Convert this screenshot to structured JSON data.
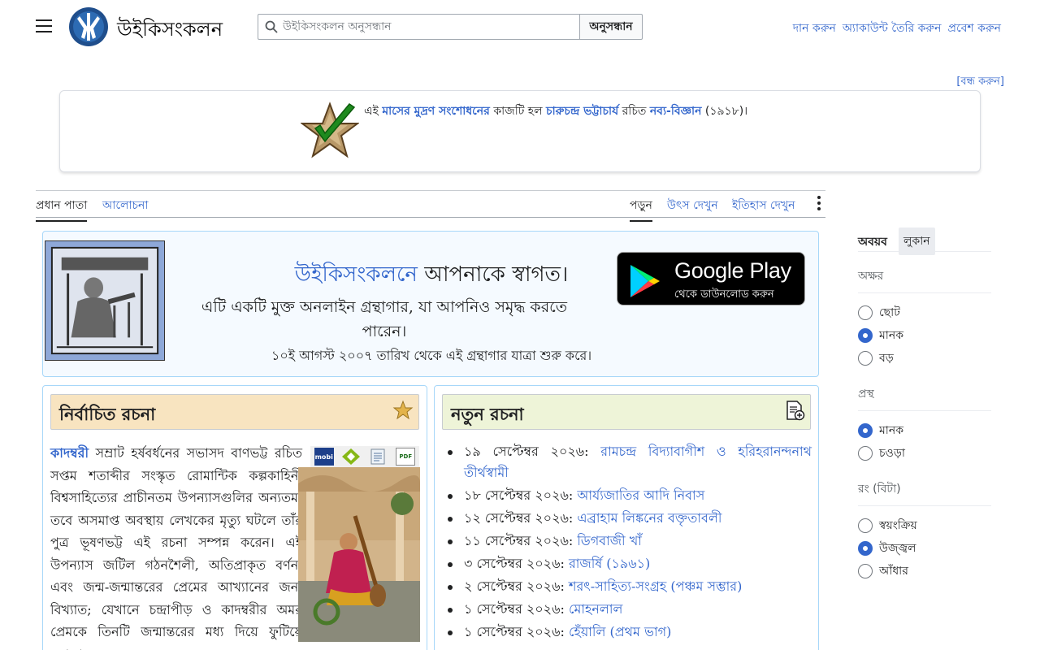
{
  "header": {
    "site_name": "উইকিসংকলন",
    "search_placeholder": "উইকিসংকলন অনুসন্ধান",
    "search_button": "অনুসন্ধান",
    "user_links": [
      "দান করুন",
      "অ্যাকাউন্ট তৈরি করুন",
      "প্রবেশ করুন"
    ]
  },
  "notice": {
    "close_label": "[বন্ধ করুন]",
    "text_prefix": "এই",
    "link1": "মাসের মুদ্রণ সংশোধনের",
    "text_mid1": " কাজটি হল ",
    "link2": "চারুচন্দ্র ভট্টাচার্য",
    "text_mid2": " রচিত ",
    "link3": "নব্য-বিজ্ঞান",
    "text_suffix": " (১৯১৮)।"
  },
  "tabs": {
    "left": [
      "প্রধান পাতা",
      "আলোচনা"
    ],
    "right": [
      "পড়ুন",
      "উৎস দেখুন",
      "ইতিহাস দেখুন"
    ]
  },
  "welcome": {
    "title_link": "উইকিসংকলনে",
    "title_rest": " আপনাকে স্বাগত।",
    "subtitle": "এটি একটি মুক্ত অনলাইন গ্রন্থাগার, যা আপনিও সমৃদ্ধ করতে পারেন।",
    "since": "১০ই আগস্ট ২০০৭ তারিখ থেকে এই গ্রন্থাগার যাত্রা শুরু করে।",
    "gplay_title": "Google Play",
    "gplay_sub": "থেকে ডাউনলোড করুন"
  },
  "featured": {
    "title": "নির্বাচিত রচনা",
    "lead_link": "কাদম্বরী",
    "body": " সম্রাট হর্ষবর্ধনের সভাসদ বাণভট্ট রচিত সপ্তম শতাব্দীর সংস্কৃত রোমান্টিক কল্পকাহিনী বিশ্বসাহিত্যের প্রাচীনতম উপন্যাসগুলির অন্যতম, তবে অসমাপ্ত অবস্থায় লেখকের মৃত্যু ঘটলে তাঁর পুত্র ভূষণভট্ট এই রচনা সম্পন্ন করেন। এই উপন্যাস জটিল গঠনশৈলী, অতিপ্রাকৃত বর্ণনা এবং জন্ম-জন্মান্তরের প্রেমের আখ্যানের জন্য বিখ্যাত; যেখানে চন্দ্রাপীড় ও কাদম্বরীর অমর প্রেমকে তিনটি জন্মান্তরের মধ্য দিয়ে ফুটিয়ে তোলা",
    "format_labels": [
      "mobi",
      "PDF"
    ]
  },
  "new_works": {
    "title": "নতুন রচনা",
    "items": [
      {
        "date": "১৯ সেপ্টেম্বর ২০২৬:",
        "title": "রামচন্দ্র বিদ্যাবাগীশ ও হরিহরানন্দনাথ তীর্থস্বামী"
      },
      {
        "date": "১৮ সেপ্টেম্বর ২০২৬:",
        "title": "আর্য্যজাতির আদি নিবাস"
      },
      {
        "date": "১২ সেপ্টেম্বর ২০২৬:",
        "title": "এব্রাহাম লিঙ্কনের বক্তৃতাবলী"
      },
      {
        "date": "১১ সেপ্টেম্বর ২০২৬:",
        "title": "ডিগবাজী খাঁ"
      },
      {
        "date": "৩ সেপ্টেম্বর ২০২৬:",
        "title": "রাজর্ষি (১৯৬১)"
      },
      {
        "date": "২ সেপ্টেম্বর ২০২৬:",
        "title": "শরৎ-সাহিত্য-সংগ্রহ (পঞ্চম সম্ভার)"
      },
      {
        "date": "১ সেপ্টেম্বর ২০২৬:",
        "title": "মোহনলাল"
      },
      {
        "date": "১ সেপ্টেম্বর ২০২৬:",
        "title": "হেঁয়ালি (প্রথম ভাগ)"
      }
    ]
  },
  "appearance": {
    "title": "অবয়ব",
    "hide": "লুকান",
    "text_label": "অক্ষর",
    "text_options": [
      "ছোট",
      "মানক",
      "বড়"
    ],
    "width_label": "প্রস্থ",
    "width_options": [
      "মানক",
      "চওড়া"
    ],
    "color_label": "রং (বিটা)",
    "color_options": [
      "স্বয়ংক্রিয়",
      "উজ্জ্বল",
      "আঁধার"
    ],
    "selected": {
      "text": 1,
      "width": 0,
      "color": 1
    }
  }
}
